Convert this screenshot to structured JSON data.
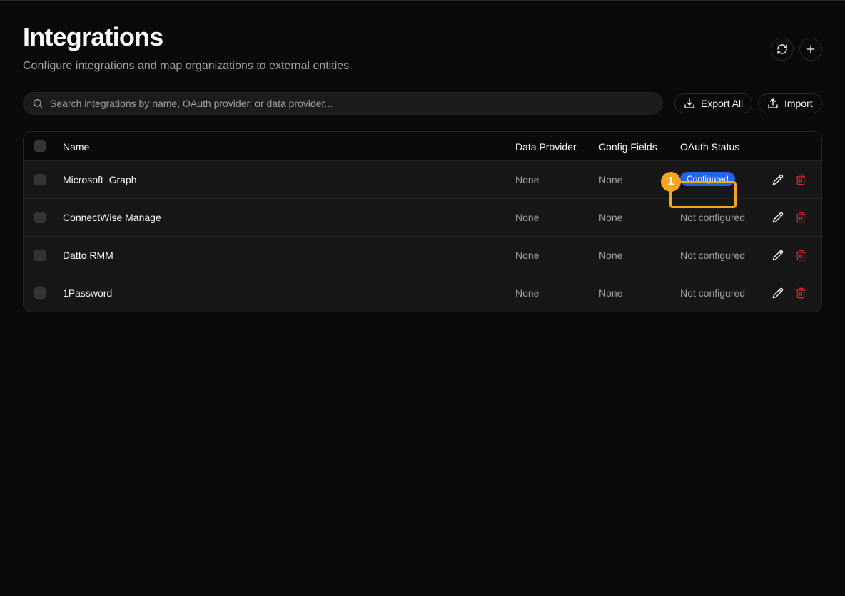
{
  "page": {
    "title": "Integrations",
    "subtitle": "Configure integrations and map organizations to external entities"
  },
  "header_actions": {
    "refresh_icon": "refresh-icon",
    "add_icon": "plus-icon"
  },
  "search": {
    "placeholder": "Search integrations by name, OAuth provider, or data provider...",
    "value": "",
    "icon": "search-icon"
  },
  "toolbar": {
    "export_label": "Export All",
    "import_label": "Import"
  },
  "table": {
    "columns": {
      "name": "Name",
      "data_provider": "Data Provider",
      "config_fields": "Config Fields",
      "oauth_status": "OAuth Status"
    },
    "rows": [
      {
        "name": "Microsoft_Graph",
        "data_provider": "None",
        "config_fields": "None",
        "oauth_status": "Configured",
        "configured": true
      },
      {
        "name": "ConnectWise Manage",
        "data_provider": "None",
        "config_fields": "None",
        "oauth_status": "Not configured",
        "configured": false
      },
      {
        "name": "Datto RMM",
        "data_provider": "None",
        "config_fields": "None",
        "oauth_status": "Not configured",
        "configured": false
      },
      {
        "name": "1Password",
        "data_provider": "None",
        "config_fields": "None",
        "oauth_status": "Not configured",
        "configured": false
      }
    ]
  },
  "annotation": {
    "marker_label": "1",
    "color": "#f5a524"
  },
  "colors": {
    "background": "#0a0a0a",
    "accent": "#2563eb",
    "danger": "#dc2626",
    "muted_text": "#a1a1a1"
  }
}
